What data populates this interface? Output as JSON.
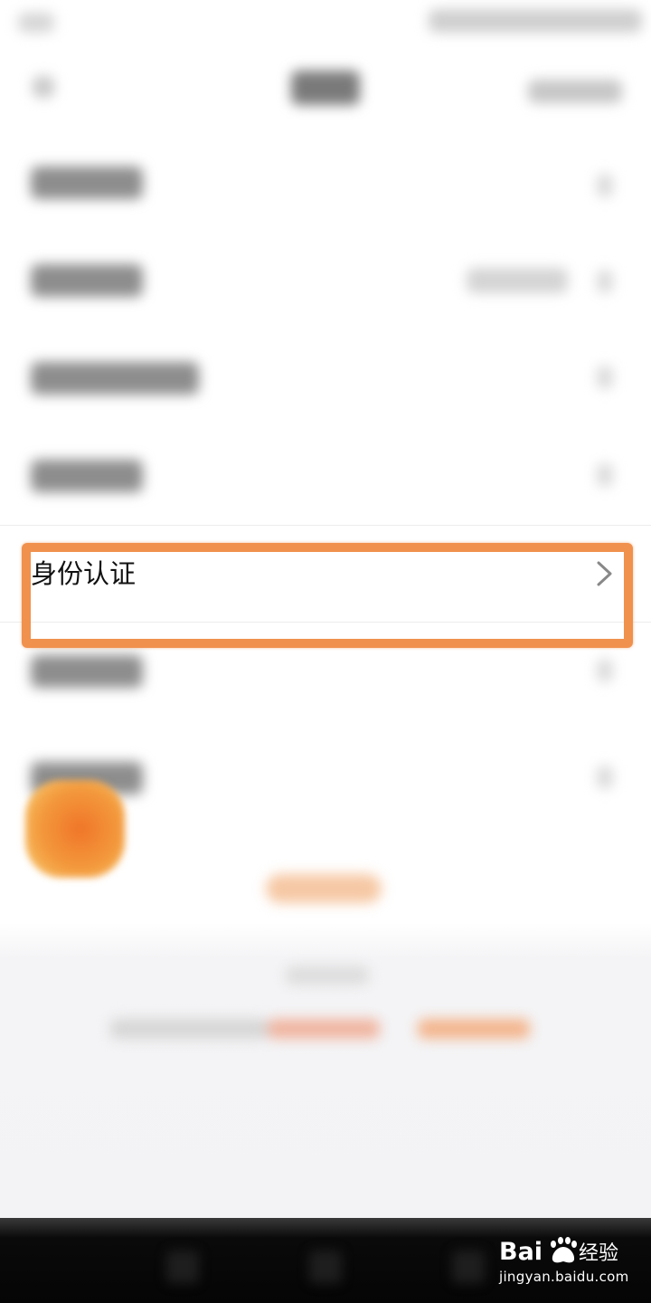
{
  "settings": {
    "highlighted_item": {
      "label": "身份认证",
      "icon": "chevron-right-icon"
    }
  },
  "watermark": {
    "logo_text": "Bai经验",
    "url": "jingyan.baidu.com"
  },
  "colors": {
    "highlight_border": "#f0914d",
    "accent_orange": "#f39a3d",
    "chevron": "#888888"
  }
}
